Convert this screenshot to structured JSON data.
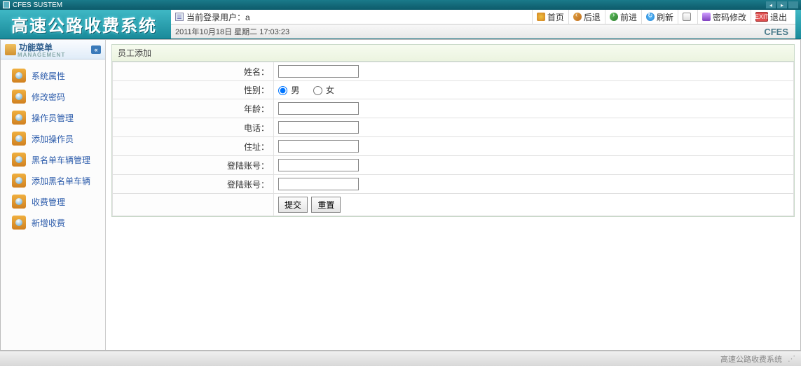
{
  "window": {
    "title": "CFES SUSTEM"
  },
  "header": {
    "app_title": "高速公路收费系统",
    "current_user_label": "当前登录用户：a",
    "datetime": "2011年10月18日  星期二  17:03:23",
    "brand": "CFES"
  },
  "toolbar": {
    "home": "首页",
    "back": "后退",
    "forward": "前进",
    "refresh": "刷新",
    "pwd": "密码修改",
    "exit": "退出",
    "exit_badge": "EXIT"
  },
  "sidebar": {
    "title": "功能菜单",
    "subtitle": "MANAGEMENT",
    "items": [
      {
        "label": "系统属性"
      },
      {
        "label": "修改密码"
      },
      {
        "label": "操作员管理"
      },
      {
        "label": "添加操作员"
      },
      {
        "label": "黑名单车辆管理"
      },
      {
        "label": "添加黑名单车辆"
      },
      {
        "label": "收费管理"
      },
      {
        "label": "新增收费"
      }
    ]
  },
  "panel": {
    "title": "员工添加",
    "fields": {
      "name_label": "姓名：",
      "gender_label": "性别：",
      "gender_male": "男",
      "gender_female": "女",
      "age_label": "年龄：",
      "phone_label": "电话：",
      "address_label": "住址：",
      "login1_label": "登陆账号：",
      "login2_label": "登陆账号：",
      "name_value": "",
      "age_value": "",
      "phone_value": "",
      "address_value": "",
      "login1_value": "",
      "login2_value": ""
    },
    "buttons": {
      "submit": "提交",
      "reset": "重置"
    }
  },
  "statusbar": {
    "text": "高速公路收费系统"
  }
}
